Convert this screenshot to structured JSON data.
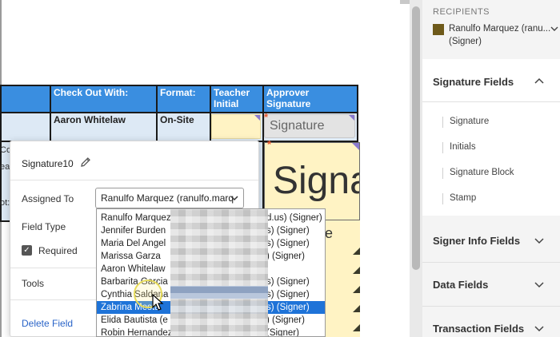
{
  "table": {
    "headers": [
      "",
      "Check Out With:",
      "Format:",
      "Teacher Initial",
      "Approver Signature"
    ],
    "row1": {
      "check_out_with": "Aaron Whitelaw",
      "format": "On-Site"
    },
    "left_fragments": [
      "Co",
      "ear",
      "ot:"
    ]
  },
  "fields": {
    "small_signature_label": "Signature",
    "large_signature_label": "Signa",
    "partial_letter": "e",
    "required_marker": "*"
  },
  "popup": {
    "field_name": "Signature10",
    "assigned_to_label": "Assigned To",
    "assigned_to_value": "Ranulfo Marquez (ranulfo.marq",
    "field_type_label": "Field Type",
    "required_label": "Required",
    "required_checked": true,
    "tools_label": "Tools",
    "delete_label": "Delete Field"
  },
  "dropdown": {
    "selected_index": 7,
    "options": [
      {
        "name": "Ranulfo Marquez",
        "suffix": "d.us) (Signer)"
      },
      {
        "name": "Jennifer Burden",
        "suffix": "s) (Signer)"
      },
      {
        "name": "Maria Del Angel",
        "suffix": "s) (Signer)"
      },
      {
        "name": "Marissa Garza",
        "suffix": ") (Signer)"
      },
      {
        "name": "Aaron Whitelaw",
        "suffix": ""
      },
      {
        "name": "Barbarita Garcia",
        "suffix": "s) (Signer)"
      },
      {
        "name": "Cynthia Saldana",
        "suffix": "s) (Signer)"
      },
      {
        "name": "Zabrina Mesta",
        "suffix": "s) (Signer)"
      },
      {
        "name": "Elida Bautista (e",
        "suffix": ") (Signer)"
      },
      {
        "name": "Robin Hernandez",
        "suffix": "(Signer)"
      }
    ]
  },
  "panel": {
    "recipients_header": "RECIPIENTS",
    "recipient_name": "Ranulfo Marquez (ranu... (Signer)",
    "recipient_color": "#6e5a1a",
    "signature_fields_title": "Signature Fields",
    "signature_items": [
      "Signature",
      "Initials",
      "Signature Block",
      "Stamp"
    ],
    "signer_info_title": "Signer Info Fields",
    "data_fields_title": "Data Fields",
    "transaction_fields_title": "Transaction Fields"
  },
  "colors": {
    "header_blue": "#3a8ee0",
    "field_yellow": "#fff3c4",
    "selection_blue": "#1e73d8",
    "link_blue": "#2a64c8"
  }
}
